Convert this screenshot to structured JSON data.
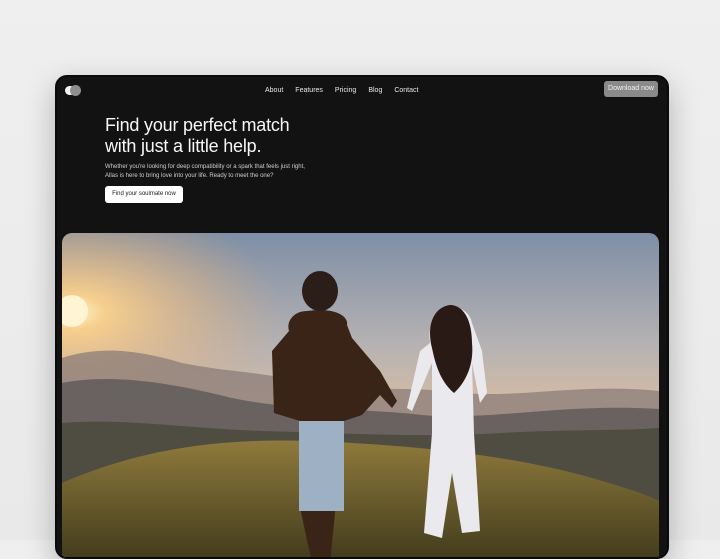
{
  "nav": {
    "items": [
      "About",
      "Features",
      "Pricing",
      "Blog",
      "Contact"
    ],
    "download_label": "Download now"
  },
  "hero": {
    "title_line1": "Find your perfect match",
    "title_line2": "with just a little help.",
    "subtitle": "Whether you're looking for deep compatibility or a spark that feels just right, Allas is here to bring love into your life. Ready to meet the one?",
    "cta_label": "Find your soulmate now"
  },
  "colors": {
    "frame": "#121212",
    "page_background": "#efefef",
    "download_button": "#8a8a8a",
    "cta_button": "#ffffff"
  },
  "icons": {
    "logo": "two-overlapping-pills-logo"
  }
}
